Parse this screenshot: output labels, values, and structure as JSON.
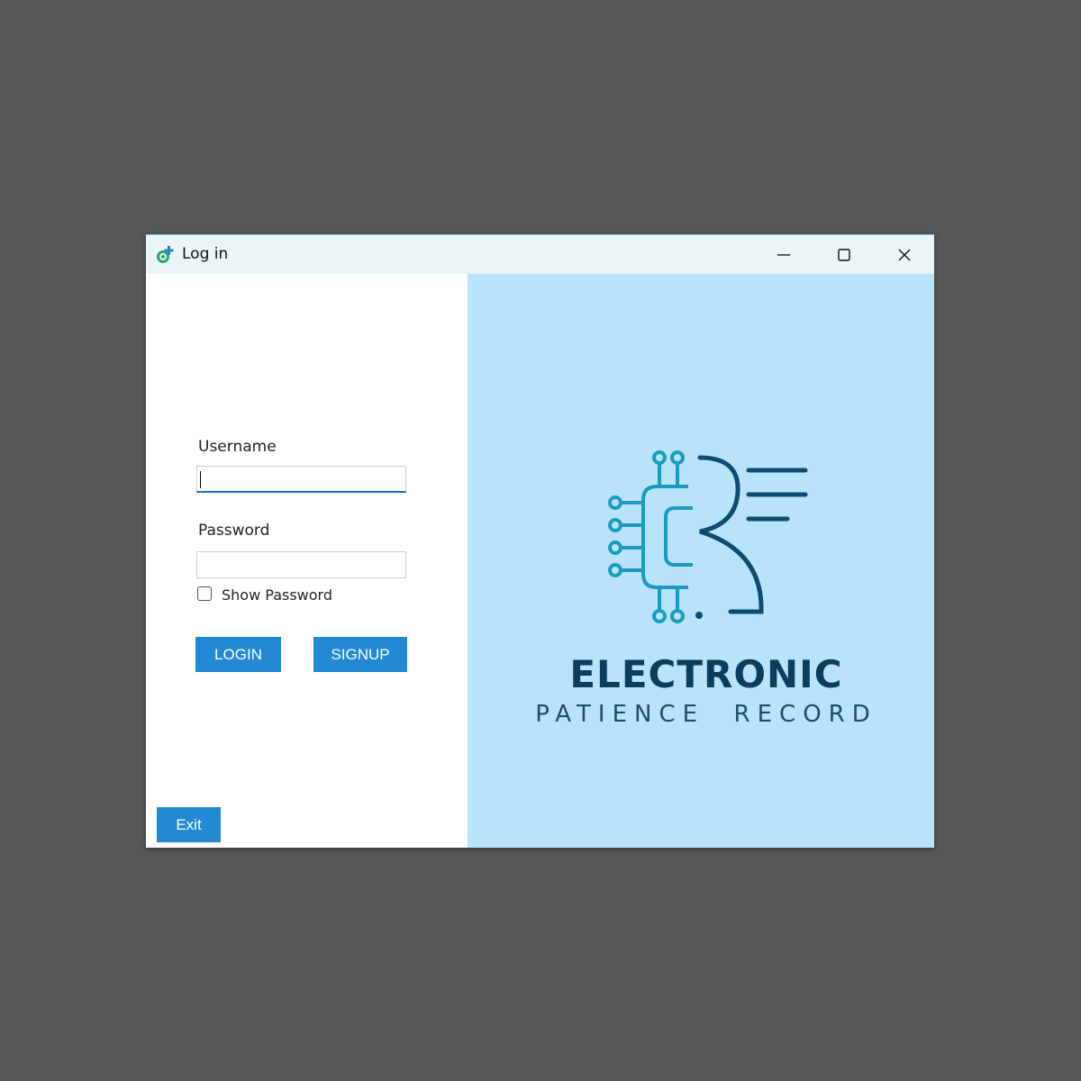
{
  "window": {
    "title": "Log in",
    "app_icon": "gear-plus-icon",
    "controls": [
      "minimize-icon",
      "maximize-icon",
      "close-icon"
    ]
  },
  "form": {
    "username_label": "Username",
    "username_value": "",
    "password_label": "Password",
    "password_value": "",
    "show_password_label": "Show Password",
    "show_password_checked": false,
    "login_label": "LOGIN",
    "signup_label": "SIGNUP",
    "exit_label": "Exit"
  },
  "brand": {
    "title": "ELECTRONIC",
    "subtitle": "PATIENCE  RECORD",
    "logo_icon": "circuit-letter-b-logo"
  },
  "colors": {
    "button": "#2389d4",
    "brand_panel": "#b9e3fb",
    "brand_text": "#0b3d5c",
    "logo_cyan": "#1a9cc0",
    "logo_navy": "#0d4b73"
  }
}
